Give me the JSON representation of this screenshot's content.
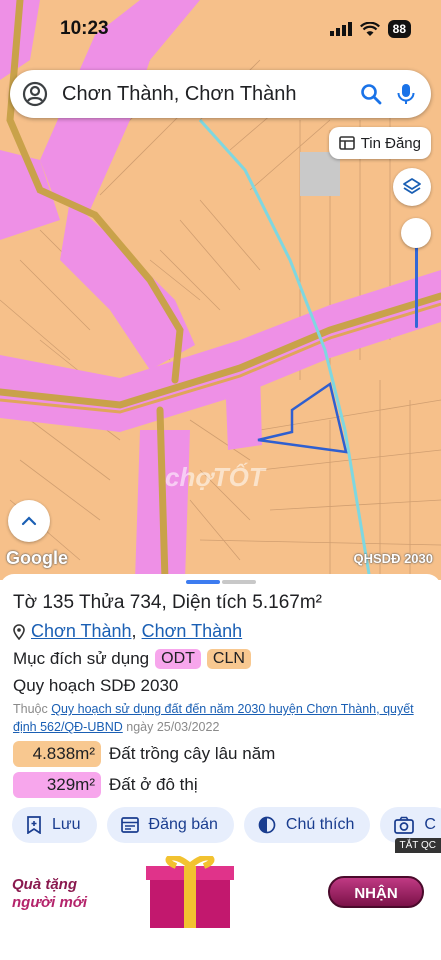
{
  "status_bar": {
    "time": "10:23",
    "battery": "88"
  },
  "search": {
    "query": "Chơn Thành, Chơn Thành"
  },
  "map": {
    "tin_dang_label": "Tin Đăng",
    "google_label": "Google",
    "layer_label": "QHSDĐ 2030",
    "watermark": "chợTỐT",
    "colors": {
      "land": "#f6c08a",
      "road_zone": "#ee90e6",
      "road": "#c9a24a",
      "parcel_outline": "#2f5fd0",
      "river": "#7fd7e0"
    }
  },
  "parcel": {
    "title_prefix": "Tờ",
    "sheet_no": "135",
    "lot_prefix": "Thửa",
    "lot_no": "734,",
    "area_prefix": "Diện tích",
    "area": "5.167m²",
    "location": {
      "district": "Chơn Thành",
      "sep": ",",
      "commune": "Chơn Thành"
    },
    "purpose_label": "Mục đích sử dụng",
    "purpose_tags": [
      "ODT",
      "CLN"
    ],
    "plan_label": "Quy hoạch SDĐ 2030",
    "source_prefix": "Thuộc",
    "source_link": "Quy hoạch sử dụng đất đến năm 2030 huyện Chơn Thành, quyết định 562/QĐ-UBND",
    "source_date": "ngày 25/03/2022",
    "areas": [
      {
        "value": "4.838m²",
        "label": "Đất trồng cây lâu năm",
        "color": "#f8c890"
      },
      {
        "value": "329m²",
        "label": "Đất ở đô thị",
        "color": "#f7a6ec"
      }
    ]
  },
  "actions": {
    "save": "Lưu",
    "post": "Đăng bán",
    "legend": "Chú thích",
    "capture": "C"
  },
  "ad": {
    "close_label": "TẮT QC",
    "line1": "Quà tặng",
    "line2": "người mới",
    "cta": "NHẬN"
  }
}
